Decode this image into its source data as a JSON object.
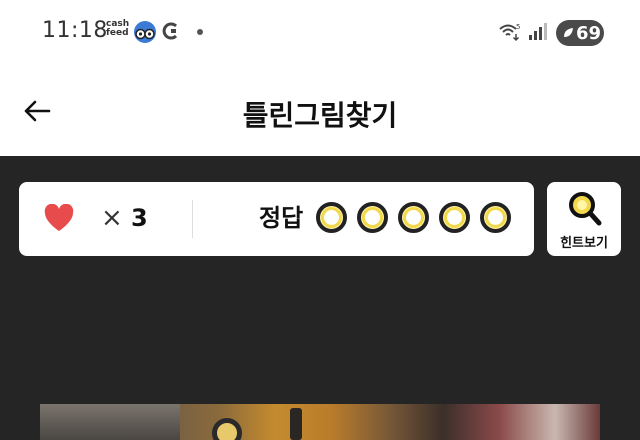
{
  "status_bar": {
    "time": "11:18",
    "cashfeed_line1": "cash",
    "cashfeed_line2": "feed",
    "wifi_badge": "5",
    "battery": "69"
  },
  "header": {
    "title": "틀린그림찾기"
  },
  "game": {
    "lives_symbol": "×",
    "lives_count": "3",
    "answer_label": "정답",
    "answers_total": 5,
    "answers_found": 0,
    "hint_label": "힌트보기"
  },
  "colors": {
    "heart": "#e84b4b",
    "game_background": "#252525",
    "answer_fill": "#fff6a8",
    "answer_ring": "#f2d84a",
    "hint_glass": "#f2d84a"
  }
}
